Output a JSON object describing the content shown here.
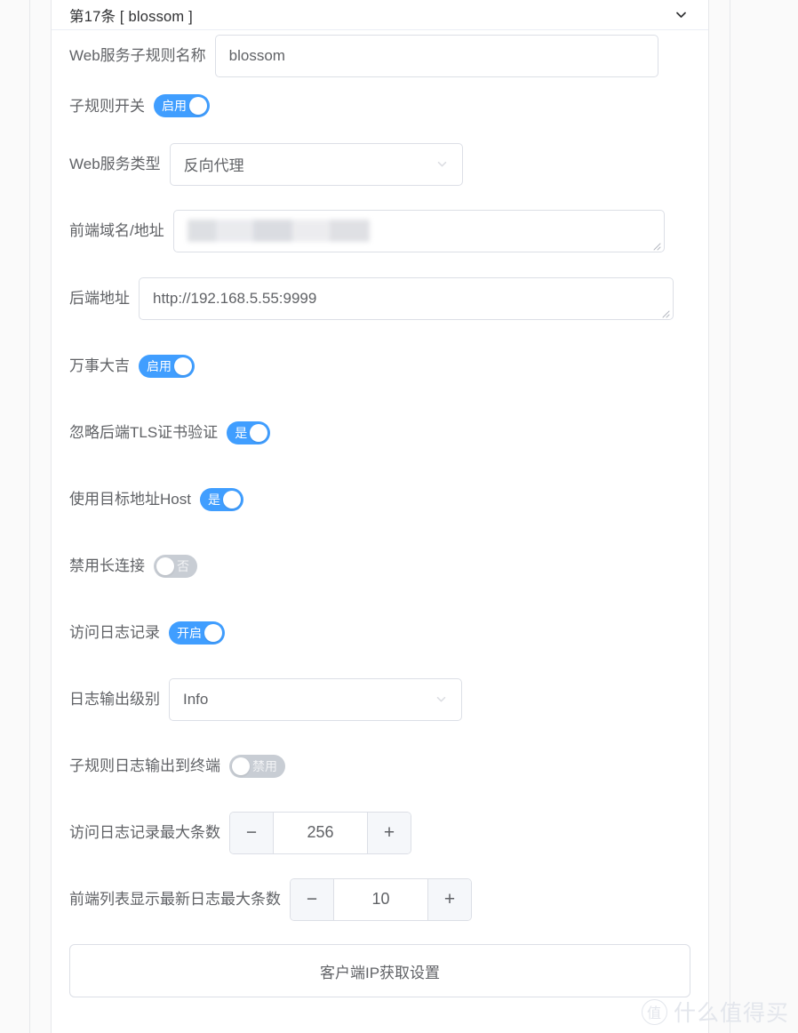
{
  "panel": {
    "collapse_title": "第17条 [ blossom ]",
    "collapse_icon": "chevron-down-icon"
  },
  "form": {
    "rule_name": {
      "label": "Web服务子规则名称",
      "value": "blossom"
    },
    "rule_switch": {
      "label": "子规则开关",
      "state_text": "启用",
      "on": true
    },
    "service_type": {
      "label": "Web服务类型",
      "value": "反向代理"
    },
    "frontend_domain": {
      "label": "前端域名/地址",
      "value": ""
    },
    "backend_address": {
      "label": "后端地址",
      "value": "http://192.168.5.55:9999"
    },
    "wanshidaji": {
      "label": "万事大吉",
      "state_text": "启用",
      "on": true
    },
    "ignore_tls": {
      "label": "忽略后端TLS证书验证",
      "state_text": "是",
      "on": true
    },
    "use_target_host": {
      "label": "使用目标地址Host",
      "state_text": "是",
      "on": true
    },
    "disable_keepalive": {
      "label": "禁用长连接",
      "state_text": "否",
      "on": false
    },
    "access_log": {
      "label": "访问日志记录",
      "state_text": "开启",
      "on": true
    },
    "log_level": {
      "label": "日志输出级别",
      "value": "Info"
    },
    "log_to_terminal": {
      "label": "子规则日志输出到终端",
      "state_text": "禁用",
      "on": false
    },
    "max_log_entries": {
      "label": "访问日志记录最大条数",
      "value": "256",
      "minus": "−",
      "plus": "+"
    },
    "max_front_log_entries": {
      "label": "前端列表显示最新日志最大条数",
      "value": "10",
      "minus": "−",
      "plus": "+"
    },
    "client_ip_button": {
      "label": "客户端IP获取设置"
    }
  },
  "watermark": {
    "mark": "值",
    "text": "什么值得买"
  },
  "colors": {
    "accent": "#409eff",
    "switch_off": "#c8cdd4",
    "border": "#dcdfe6",
    "label_text": "#606266",
    "title_text": "#303133"
  }
}
